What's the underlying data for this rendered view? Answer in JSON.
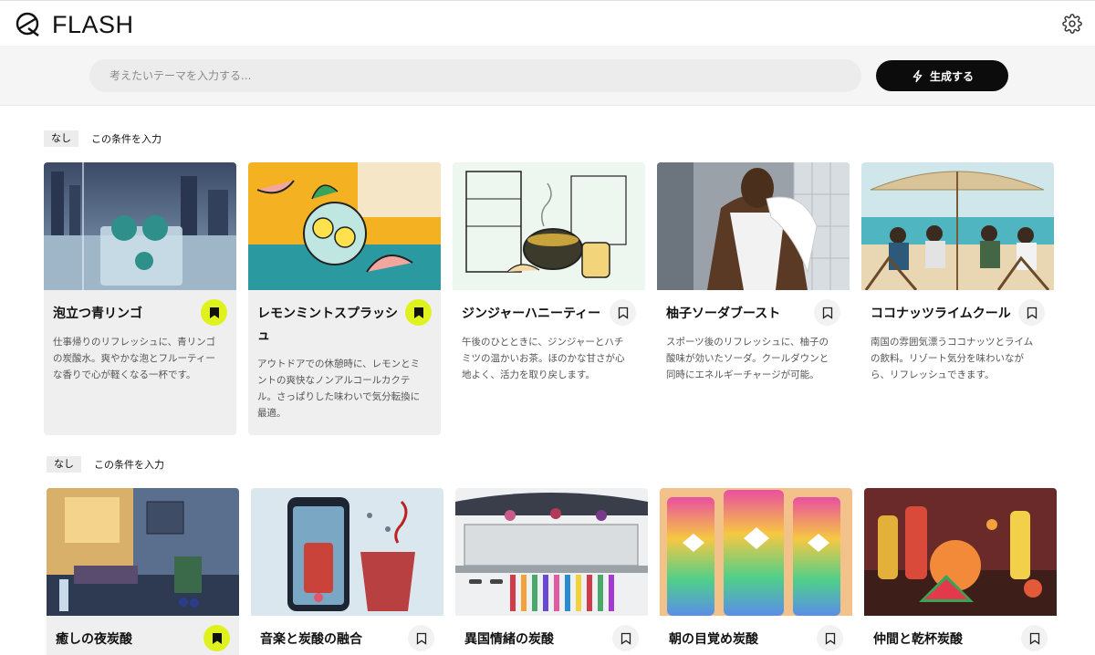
{
  "app": {
    "name": "FLASH"
  },
  "icons": {
    "logo": "logo-mark-icon",
    "settings": "gear-icon",
    "generate": "lightning-icon",
    "bookmark": "bookmark-icon"
  },
  "colors": {
    "accent": "#dff21d",
    "button": "#0c0c0c",
    "chip": "#ececec",
    "card": "#efefef"
  },
  "search": {
    "placeholder": "考えたいテーマを入力する...",
    "value": "",
    "button_label": "生成する"
  },
  "sections": [
    {
      "filter": {
        "chip": "なし",
        "condition": "この条件を入力"
      },
      "cards": [
        {
          "title": "泡立つ青リンゴ",
          "desc": "仕事帰りのリフレッシュに、青リンゴの炭酸水。爽やかな泡とフルーティーな香りで心が軽くなる一杯です。",
          "saved": true
        },
        {
          "title": "レモンミントスプラッシュ",
          "desc": "アウトドアでの休憩時に、レモンとミントの爽快なノンアルコールカクテル。さっぱりした味わいで気分転換に最適。",
          "saved": true
        },
        {
          "title": "ジンジャーハニーティー",
          "desc": "午後のひとときに、ジンジャーとハチミツの温かいお茶。ほのかな甘さが心地よく、活力を取り戻します。",
          "saved": false
        },
        {
          "title": "柚子ソーダブースト",
          "desc": "スポーツ後のリフレッシュに、柚子の酸味が効いたソーダ。クールダウンと同時にエネルギーチャージが可能。",
          "saved": false
        },
        {
          "title": "ココナッツライムクール",
          "desc": "南国の雰囲気漂うココナッツとライムの飲料。リゾート気分を味わいながら、リフレッシュできます。",
          "saved": false
        }
      ]
    },
    {
      "filter": {
        "chip": "なし",
        "condition": "この条件を入力"
      },
      "cards": [
        {
          "title": "癒しの夜炭酸",
          "saved": true
        },
        {
          "title": "音楽と炭酸の融合",
          "saved": false
        },
        {
          "title": "異国情緒の炭酸",
          "saved": false
        },
        {
          "title": "朝の目覚め炭酸",
          "saved": false
        },
        {
          "title": "仲間と乾杯炭酸",
          "saved": false
        }
      ]
    }
  ]
}
